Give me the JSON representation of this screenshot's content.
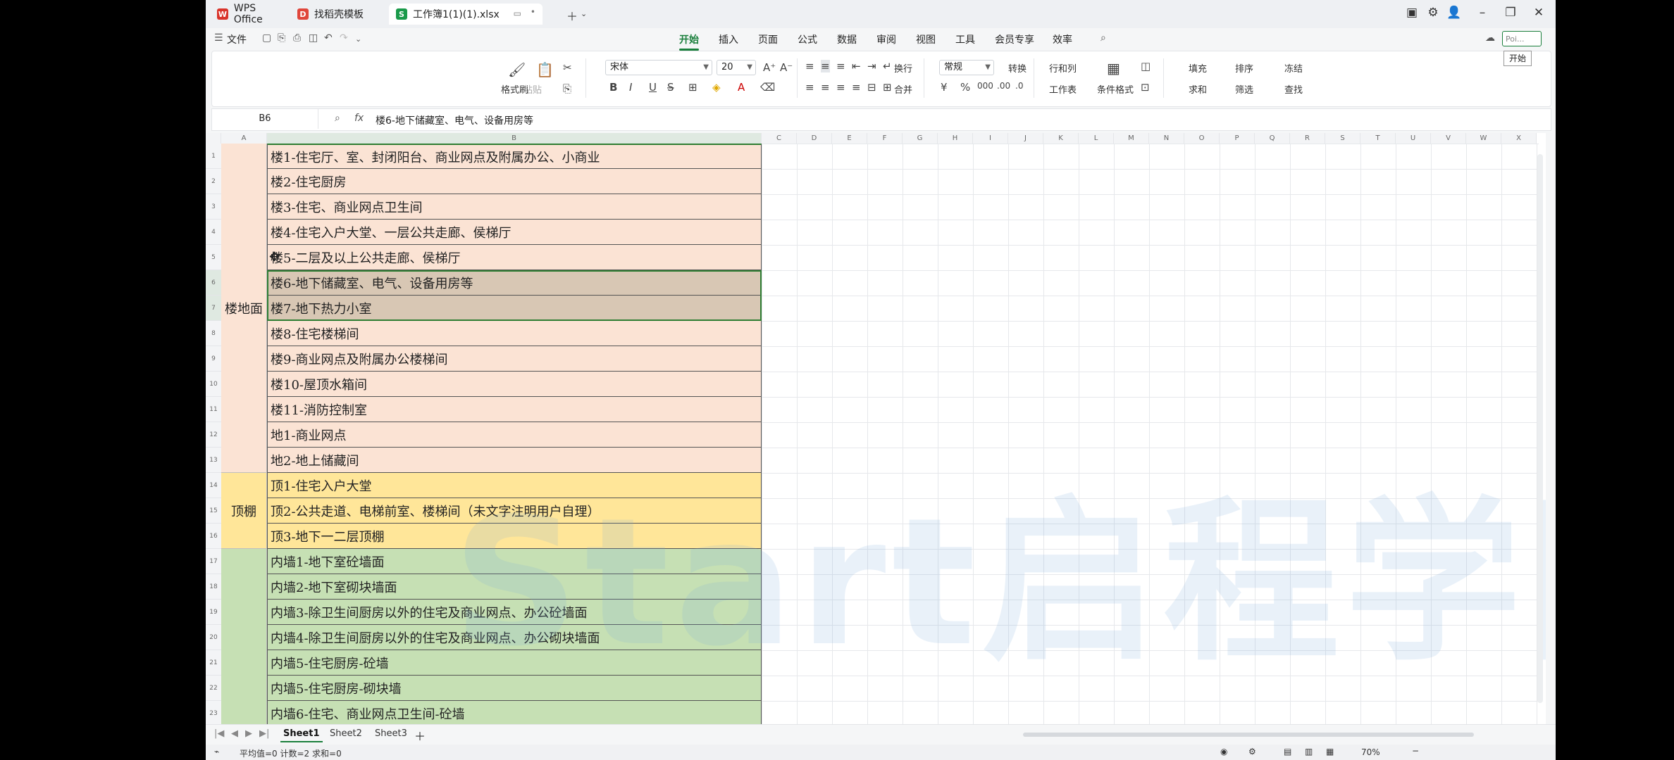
{
  "tabs": [
    {
      "label": "WPS Office"
    },
    {
      "label": "找稻壳模板"
    },
    {
      "label": "工作簿1(1)(1).xlsx"
    }
  ],
  "menu": {
    "file": "文件",
    "items": [
      "开始",
      "插入",
      "页面",
      "公式",
      "数据",
      "审阅",
      "视图",
      "工具",
      "会员专享",
      "效率"
    ],
    "active": "开始",
    "tooltip": "开始",
    "search_hint": "Poi..."
  },
  "ribbon": {
    "format_painter": "格式刷",
    "paste": "粘贴",
    "font": "宋体",
    "size": "20",
    "wrap": "换行",
    "merge": "合并",
    "number_format": "常规",
    "convert": "转换",
    "rowcol": "行和列",
    "sheet": "工作表",
    "cond_format": "条件格式",
    "fill": "填充",
    "sort": "排序",
    "freeze": "冻结",
    "sum": "求和",
    "filter": "筛选",
    "find": "查找"
  },
  "formula": {
    "cell_ref": "B6",
    "fx": "fx",
    "content": "楼6-地下储藏室、电气、设备用房等"
  },
  "columns": [
    "A",
    "B",
    "C",
    "D",
    "E",
    "F",
    "G",
    "H",
    "I",
    "J",
    "K",
    "L",
    "M",
    "N",
    "O",
    "P",
    "Q",
    "R",
    "S",
    "T",
    "U",
    "V",
    "W",
    "X"
  ],
  "groups": [
    {
      "label": "楼地面",
      "color": "#fbe3d4"
    },
    {
      "label": "顶棚",
      "color": "#ffe699"
    },
    {
      "label": "",
      "color": "#c6e0b4"
    }
  ],
  "rows": [
    {
      "n": "1",
      "text": "楼1-住宅厅、室、封闭阳台、商业网点及附属办公、小商业"
    },
    {
      "n": "2",
      "text": "楼2-住宅厨房"
    },
    {
      "n": "3",
      "text": "楼3-住宅、商业网点卫生间"
    },
    {
      "n": "4",
      "text": "楼4-住宅入户大堂、一层公共走廊、侯梯厅"
    },
    {
      "n": "5",
      "text": "楼5-二层及以上公共走廊、侯梯厅"
    },
    {
      "n": "6",
      "text": "楼6-地下储藏室、电气、设备用房等"
    },
    {
      "n": "7",
      "text": "楼7-地下热力小室"
    },
    {
      "n": "8",
      "text": "楼8-住宅楼梯间"
    },
    {
      "n": "9",
      "text": "楼9-商业网点及附属办公楼梯间"
    },
    {
      "n": "10",
      "text": "楼10-屋顶水箱间"
    },
    {
      "n": "11",
      "text": "楼11-消防控制室"
    },
    {
      "n": "12",
      "text": "地1-商业网点"
    },
    {
      "n": "13",
      "text": "地2-地上储藏间"
    },
    {
      "n": "14",
      "text": "顶1-住宅入户大堂"
    },
    {
      "n": "15",
      "text": "顶2-公共走道、电梯前室、楼梯间（未文字注明用户自理）"
    },
    {
      "n": "16",
      "text": "顶3-地下一二层顶棚"
    },
    {
      "n": "17",
      "text": "内墙1-地下室砼墙面"
    },
    {
      "n": "18",
      "text": "内墙2-地下室砌块墙面"
    },
    {
      "n": "19",
      "text": "内墙3-除卫生间厨房以外的住宅及商业网点、办公砼墙面"
    },
    {
      "n": "20",
      "text": "内墙4-除卫生间厨房以外的住宅及商业网点、办公砌块墙面"
    },
    {
      "n": "21",
      "text": "内墙5-住宅厨房-砼墙"
    },
    {
      "n": "22",
      "text": "内墙5-住宅厨房-砌块墙"
    },
    {
      "n": "23",
      "text": "内墙6-住宅、商业网点卫生间-砼墙"
    }
  ],
  "watermark": "Start启程学院",
  "sheets": [
    "Sheet1",
    "Sheet2",
    "Sheet3"
  ],
  "status": {
    "summary": "平均值=0  计数=2  求和=0",
    "zoom": "70%"
  }
}
